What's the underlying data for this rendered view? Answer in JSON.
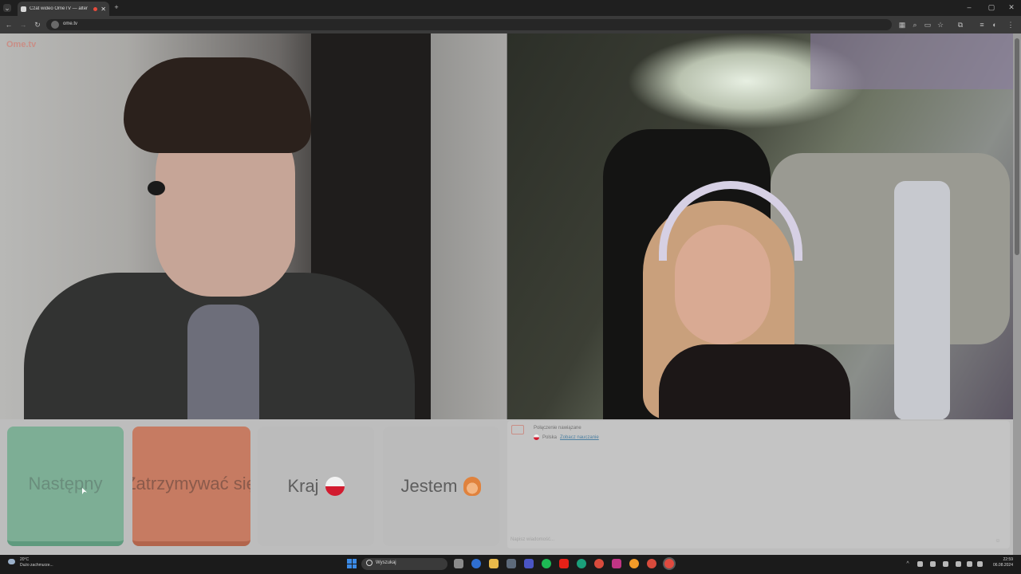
{
  "browser": {
    "tab_title": "Czat wideo OmeTV — alter",
    "tab_close": "✕",
    "new_tab": "+",
    "url": "ome.tv",
    "window_controls": [
      "–",
      "▢",
      "✕"
    ]
  },
  "site": {
    "logo": "Ome.tv"
  },
  "buttons": {
    "next": "Następny",
    "stop": "Zatrzymywać się",
    "country": "Kraj",
    "gender": "Jestem"
  },
  "chat": {
    "connection_message": "Połączenie nawiązane",
    "country": "Polska",
    "link": "Zobacz nauczanie",
    "input_placeholder": "Napisz wiadomość..."
  },
  "taskbar": {
    "weather_temp": "20°C",
    "weather_desc": "Dużo zachmurze...",
    "search_placeholder": "Wyszukaj",
    "time": "22:59",
    "date": "06.08.2024"
  },
  "colors": {
    "next_button": "#7dae95",
    "stop_button": "#c67b62",
    "neutral_button": "#bbbbbb"
  }
}
